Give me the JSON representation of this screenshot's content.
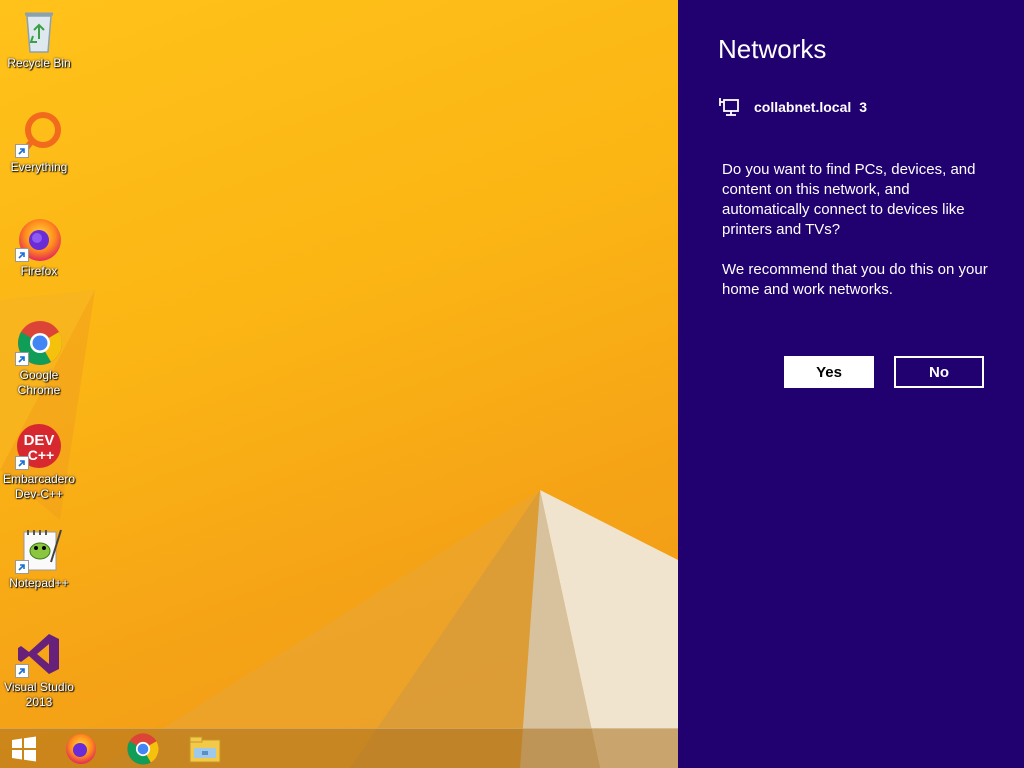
{
  "desktop": {
    "icons": [
      {
        "label_line1": "Recycle Bin",
        "label_line2": "",
        "icon": "recycle-bin-icon"
      },
      {
        "label_line1": "Everything",
        "label_line2": "",
        "icon": "everything-search-icon"
      },
      {
        "label_line1": "Firefox",
        "label_line2": "",
        "icon": "firefox-icon"
      },
      {
        "label_line1": "Google",
        "label_line2": "Chrome",
        "icon": "chrome-icon"
      },
      {
        "label_line1": "Embarcadero",
        "label_line2": "Dev-C++",
        "icon": "devcpp-icon"
      },
      {
        "label_line1": "Notepad++",
        "label_line2": "",
        "icon": "notepadpp-icon"
      },
      {
        "label_line1": "Visual Studio",
        "label_line2": "2013",
        "icon": "visual-studio-icon"
      }
    ],
    "devcpp_glyph_text": "DEV",
    "devcpp_glyph_sub": "C++"
  },
  "taskbar": {
    "items": [
      "start-icon",
      "firefox-icon",
      "chrome-icon",
      "file-explorer-icon"
    ]
  },
  "networks_pane": {
    "title": "Networks",
    "network_name": "collabnet.local",
    "network_number": "3",
    "question": "Do you want to find PCs, devices, and content on this network, and automatically connect to devices like printers and TVs?",
    "recommendation": "We recommend that you do this on your home and work networks.",
    "yes_label": "Yes",
    "no_label": "No"
  },
  "colors": {
    "pane_background": "#21006f",
    "wallpaper": "#fbb514"
  }
}
